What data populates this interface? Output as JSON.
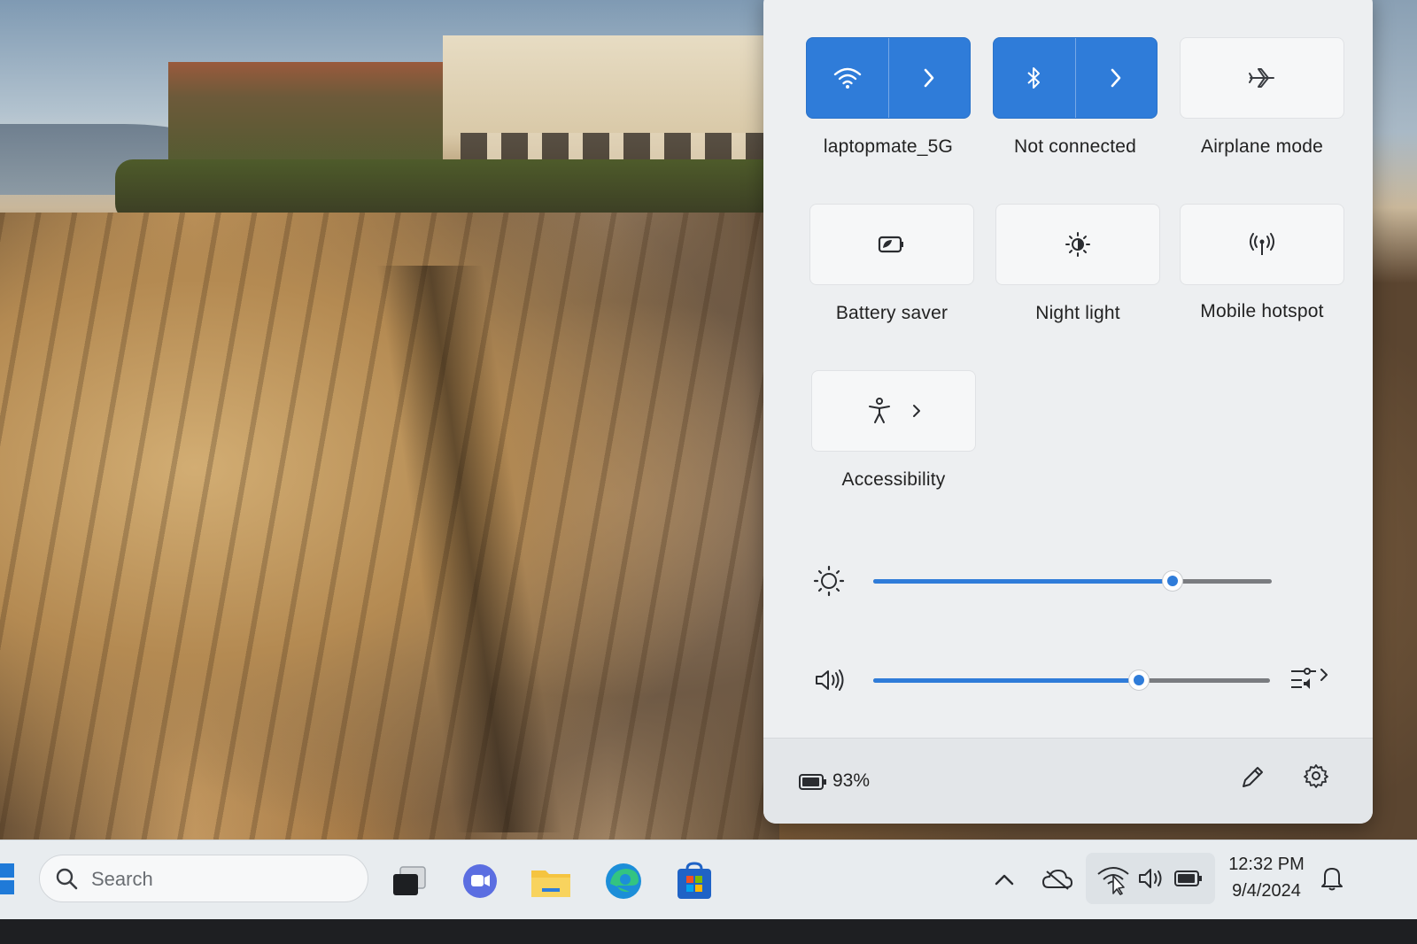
{
  "quick_settings": {
    "tiles": [
      {
        "id": "wifi",
        "label": "laptopmate_5G",
        "icon": "wifi-icon",
        "active": true,
        "has_arrow": true
      },
      {
        "id": "bluetooth",
        "label": "Not connected",
        "icon": "bluetooth-icon",
        "active": true,
        "has_arrow": true
      },
      {
        "id": "airplane",
        "label": "Airplane mode",
        "icon": "airplane-icon",
        "active": false,
        "has_arrow": false
      },
      {
        "id": "battery_saver",
        "label": "Battery saver",
        "icon": "battery-saver-icon",
        "active": false,
        "has_arrow": false
      },
      {
        "id": "night_light",
        "label": "Night light",
        "icon": "night-light-icon",
        "active": false,
        "has_arrow": false
      },
      {
        "id": "hotspot",
        "label": "Mobile hotspot",
        "icon": "mobile-hotspot-icon",
        "active": false,
        "has_arrow": false
      },
      {
        "id": "accessibility",
        "label": "Accessibility",
        "icon": "accessibility-icon",
        "active": false,
        "has_arrow": true
      }
    ],
    "brightness": {
      "icon": "brightness-icon",
      "level_fraction": 0.75
    },
    "volume": {
      "icon": "speaker-icon",
      "level_fraction": 0.67,
      "mixer_icon": "volume-mixer-icon"
    },
    "footer": {
      "battery_icon": "battery-icon",
      "battery_percent": "93%",
      "edit_icon": "pencil-icon",
      "settings_icon": "gear-icon"
    }
  },
  "taskbar": {
    "search_placeholder": "Search",
    "apps": [
      "task-view-icon",
      "teams-chat-icon",
      "file-explorer-icon",
      "edge-icon",
      "microsoft-store-icon"
    ],
    "tray": [
      "chevron-up-icon",
      "onedrive-icon",
      "wifi-icon",
      "volume-icon",
      "battery-icon",
      "notification-bell-icon"
    ],
    "time": "12:32 PM",
    "date": "9/4/2024"
  },
  "colors": {
    "accent": "#2f7cd9",
    "panel_bg": "#edeff1",
    "taskbar_bg": "#e8ecef"
  }
}
